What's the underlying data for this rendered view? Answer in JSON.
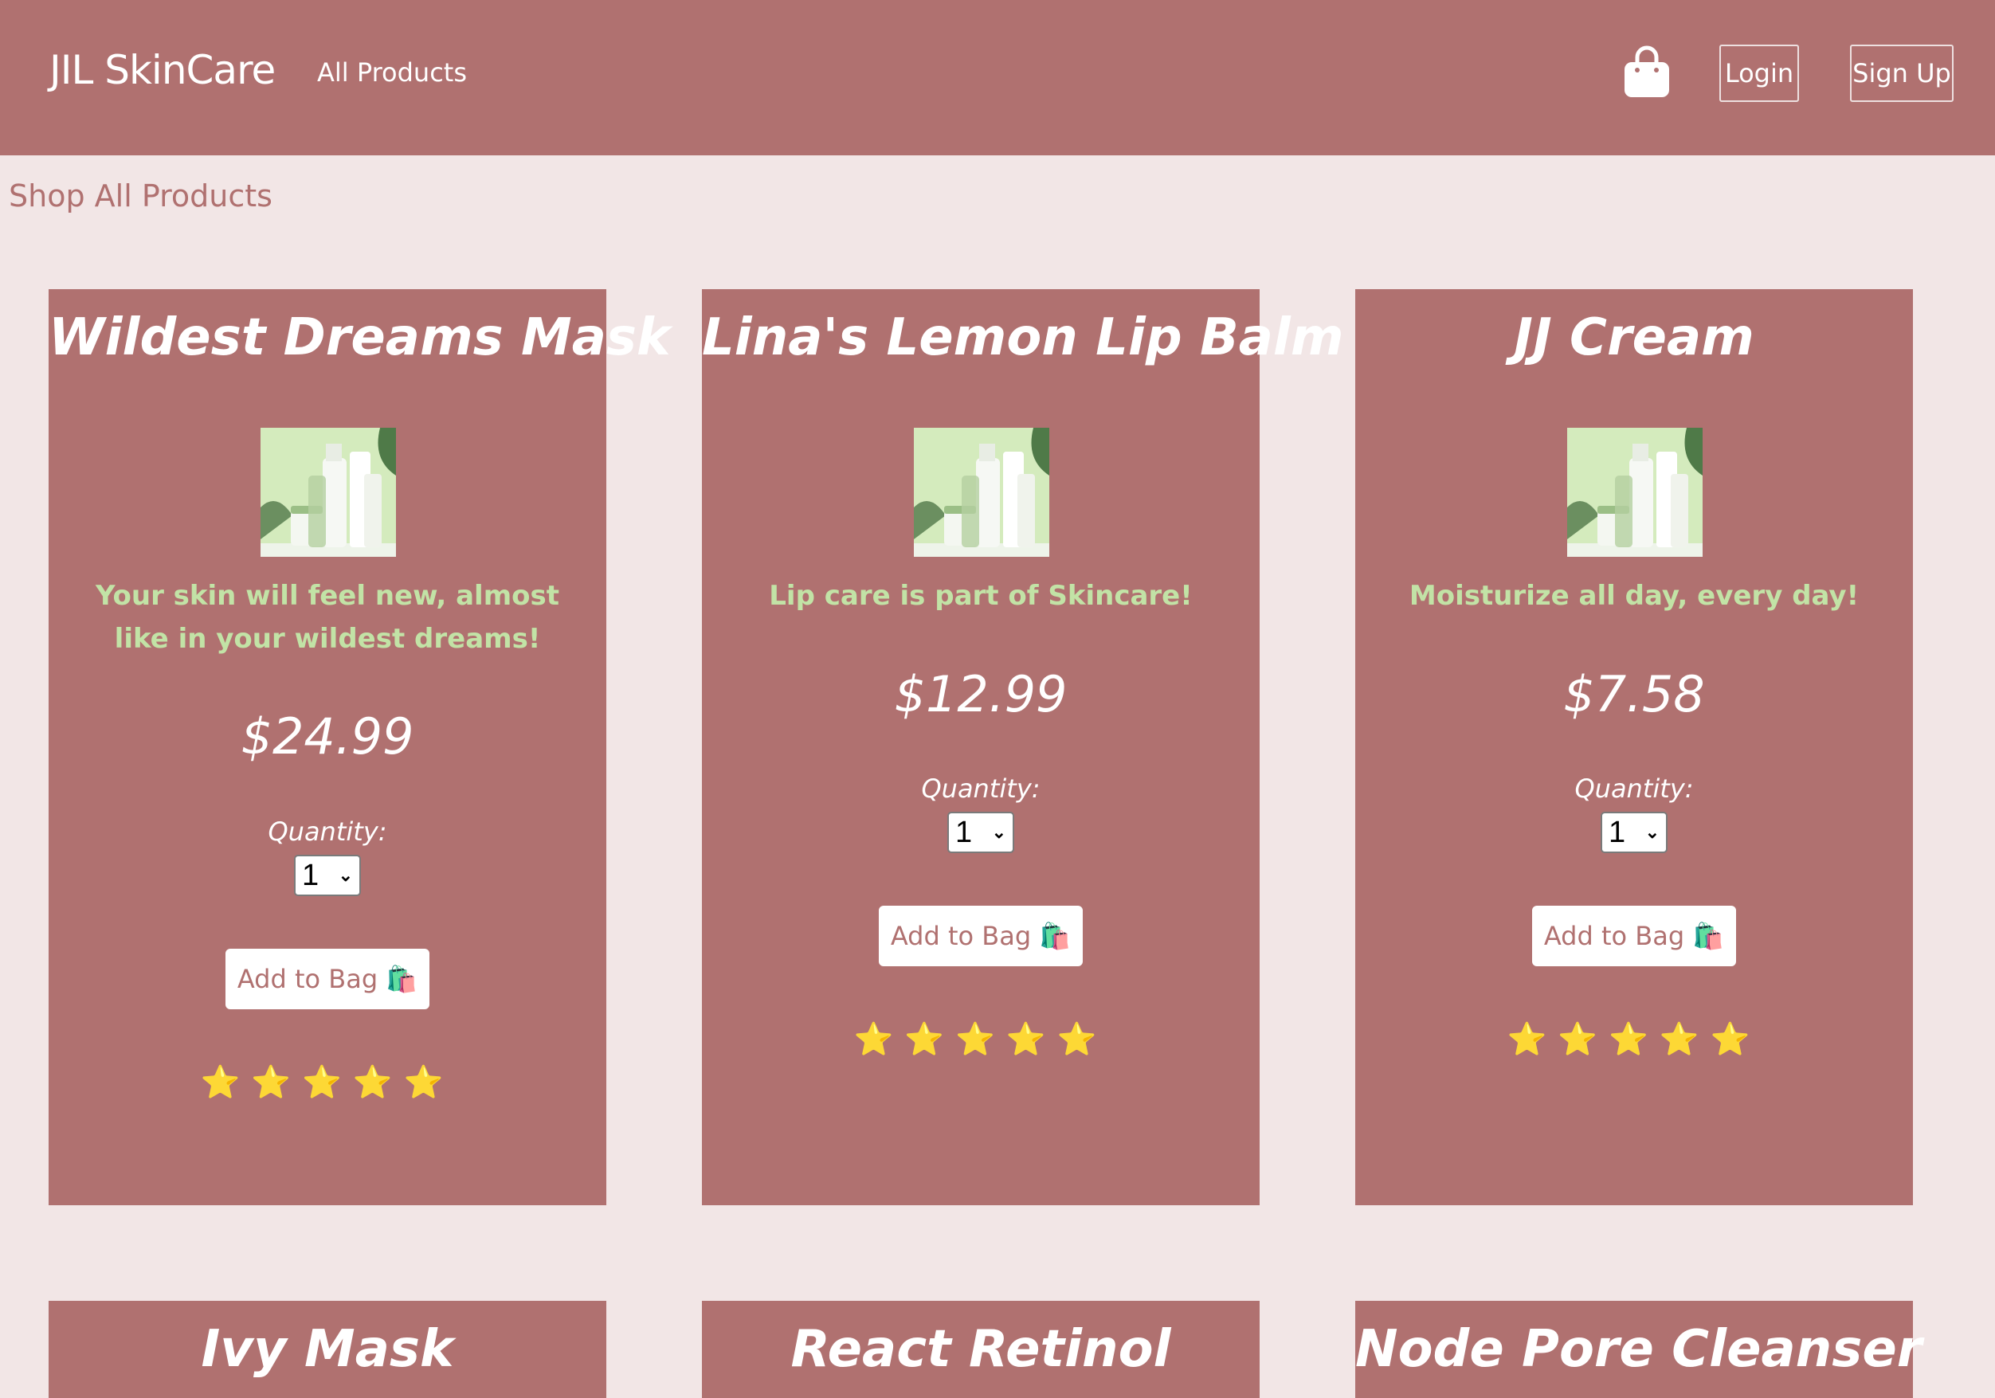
{
  "navbar": {
    "brand": "JIL SkinCare",
    "all_products": "All Products",
    "login": "Login",
    "signup": "Sign Up",
    "bag_icon": "shopping-bag-icon"
  },
  "page": {
    "title": "Shop All Products"
  },
  "colors": {
    "primary": "#b07170",
    "background": "#f2e6e6",
    "description": "#c2e3a6",
    "star": "#f5c518"
  },
  "products": [
    {
      "name": "Wildest Dreams Mask",
      "description": "Your skin will feel new, almost like in your wildest dreams!",
      "price": "$24.99",
      "quantity_label": "Quantity:",
      "quantity": "1",
      "add_label": "Add to Bag 🛍️",
      "stars": "⭐⭐⭐⭐⭐",
      "rating": 5
    },
    {
      "name": "Lina's Lemon Lip Balm",
      "description": "Lip care is part of Skincare!",
      "price": "$12.99",
      "quantity_label": "Quantity:",
      "quantity": "1",
      "add_label": "Add to Bag 🛍️",
      "stars": "⭐⭐⭐⭐⭐",
      "rating": 5
    },
    {
      "name": "JJ Cream",
      "description": "Moisturize all day, every day!",
      "price": "$7.58",
      "quantity_label": "Quantity:",
      "quantity": "1",
      "add_label": "Add to Bag 🛍️",
      "stars": "⭐⭐⭐⭐⭐",
      "rating": 5
    },
    {
      "name": "Ivy Mask"
    },
    {
      "name": "React Retinol"
    },
    {
      "name": "Node Pore Cleanser"
    }
  ]
}
